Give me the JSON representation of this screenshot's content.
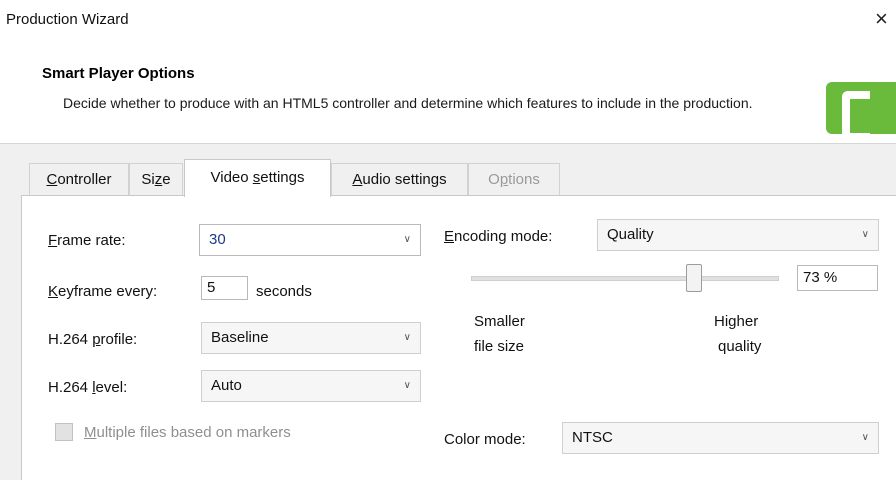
{
  "window": {
    "title": "Production Wizard",
    "close_glyph": "×"
  },
  "header": {
    "title": "Smart Player Options",
    "description": "Decide whether to produce with an HTML5 controller and determine which features to include in the production.",
    "logo_icon": "camtasia-logo-icon"
  },
  "tabs": [
    {
      "label": "Controller",
      "mnemonic": "C",
      "rest": "ontroller",
      "state": "normal"
    },
    {
      "label": "Size",
      "prefix": "Si",
      "mnemonic": "z",
      "rest": "e",
      "state": "normal"
    },
    {
      "label": "Video settings",
      "prefix": "Video ",
      "mnemonic": "s",
      "rest": "ettings",
      "state": "active"
    },
    {
      "label": "Audio settings",
      "mnemonic": "A",
      "rest": "udio settings",
      "state": "normal"
    },
    {
      "label": "Options",
      "prefix": "O",
      "mnemonic": "p",
      "rest": "tions",
      "state": "disabled"
    }
  ],
  "video": {
    "frame_rate": {
      "mnemonic": "F",
      "rest": "rame rate:",
      "value": "30"
    },
    "keyframe": {
      "mnemonic": "K",
      "rest": "eyframe every:",
      "value": "5",
      "unit": "seconds"
    },
    "profile": {
      "prefix": "H.264 ",
      "mnemonic": "p",
      "rest": "rofile:",
      "value": "Baseline"
    },
    "level": {
      "prefix": "H.264 ",
      "mnemonic": "l",
      "rest": "evel:",
      "value": "Auto"
    },
    "multiple_files": {
      "mnemonic": "M",
      "rest": "ultiple files based on markers",
      "checked": false,
      "enabled": false
    },
    "encoding_mode": {
      "mnemonic": "E",
      "rest": "ncoding mode:",
      "value": "Quality"
    },
    "quality": {
      "value_label": "73 %",
      "value_percent": 73,
      "low_label_1": "Smaller",
      "low_label_2": "file size",
      "high_label_1": "Higher",
      "high_label_2": "quality"
    },
    "color_mode": {
      "label": "Color mode:",
      "value": "NTSC"
    }
  },
  "colors": {
    "logo_green": "#6aba3c"
  }
}
